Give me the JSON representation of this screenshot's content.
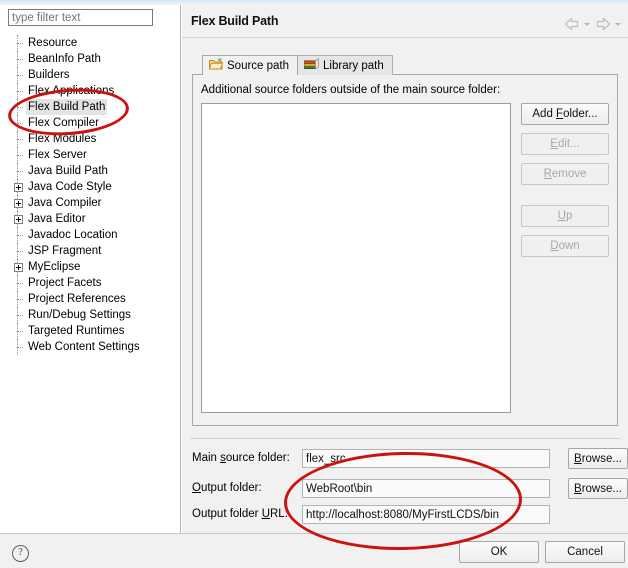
{
  "filter": {
    "placeholder": "type filter text",
    "value": ""
  },
  "tree": {
    "items": [
      {
        "label": "Resource",
        "expandable": false,
        "selected": false
      },
      {
        "label": "BeanInfo Path",
        "expandable": false,
        "selected": false
      },
      {
        "label": "Builders",
        "expandable": false,
        "selected": false
      },
      {
        "label": "Flex Applications",
        "expandable": false,
        "selected": false
      },
      {
        "label": "Flex Build Path",
        "expandable": false,
        "selected": true
      },
      {
        "label": "Flex Compiler",
        "expandable": false,
        "selected": false
      },
      {
        "label": "Flex Modules",
        "expandable": false,
        "selected": false
      },
      {
        "label": "Flex Server",
        "expandable": false,
        "selected": false
      },
      {
        "label": "Java Build Path",
        "expandable": false,
        "selected": false
      },
      {
        "label": "Java Code Style",
        "expandable": true,
        "selected": false
      },
      {
        "label": "Java Compiler",
        "expandable": true,
        "selected": false
      },
      {
        "label": "Java Editor",
        "expandable": true,
        "selected": false
      },
      {
        "label": "Javadoc Location",
        "expandable": false,
        "selected": false
      },
      {
        "label": "JSP Fragment",
        "expandable": false,
        "selected": false
      },
      {
        "label": "MyEclipse",
        "expandable": true,
        "selected": false
      },
      {
        "label": "Project Facets",
        "expandable": false,
        "selected": false
      },
      {
        "label": "Project References",
        "expandable": false,
        "selected": false
      },
      {
        "label": "Run/Debug Settings",
        "expandable": false,
        "selected": false
      },
      {
        "label": "Targeted Runtimes",
        "expandable": false,
        "selected": false
      },
      {
        "label": "Web Content Settings",
        "expandable": false,
        "selected": false
      }
    ]
  },
  "header": {
    "title": "Flex Build Path",
    "back_icon": "back-arrow-icon",
    "back_caret_icon": "chevron-down-icon",
    "forward_icon": "forward-arrow-icon",
    "forward_caret_icon": "chevron-down-icon"
  },
  "tabs": [
    {
      "label": "Source path",
      "icon": "folder-icon",
      "active": true
    },
    {
      "label": "Library path",
      "icon": "books-icon",
      "active": false
    }
  ],
  "source_path": {
    "caption": "Additional source folders outside of the main source folder:",
    "list_items": [],
    "buttons": [
      {
        "label": "Add Folder...",
        "mnemonic": "F",
        "enabled": true
      },
      {
        "label": "Edit...",
        "mnemonic": "E",
        "enabled": false
      },
      {
        "label": "Remove",
        "mnemonic": "R",
        "enabled": false
      },
      {
        "label": "Up",
        "mnemonic": "U",
        "enabled": false
      },
      {
        "label": "Down",
        "mnemonic": "D",
        "enabled": false
      }
    ]
  },
  "form": {
    "rows": [
      {
        "label": "Main source folder:",
        "mnemonic": "s",
        "value": "flex_src",
        "browse_label": "Browse...",
        "browse_mnemonic": "B"
      },
      {
        "label": "Output folder:",
        "mnemonic": "O",
        "value": "WebRoot\\bin",
        "browse_label": "Browse...",
        "browse_mnemonic": "B"
      },
      {
        "label": "Output folder URL:",
        "mnemonic": "U",
        "value": "http://localhost:8080/MyFirstLCDS/bin",
        "browse_label": "",
        "browse_mnemonic": ""
      }
    ]
  },
  "footer": {
    "help_icon": "help-question-icon",
    "help_glyph": "?",
    "ok_label": "OK",
    "cancel_label": "Cancel"
  },
  "annotations": {
    "color": "#cc1111",
    "marks": [
      {
        "name": "highlight-flex-build-path",
        "shape": "ellipse"
      },
      {
        "name": "highlight-output-folder-fields",
        "shape": "ellipse"
      }
    ]
  }
}
